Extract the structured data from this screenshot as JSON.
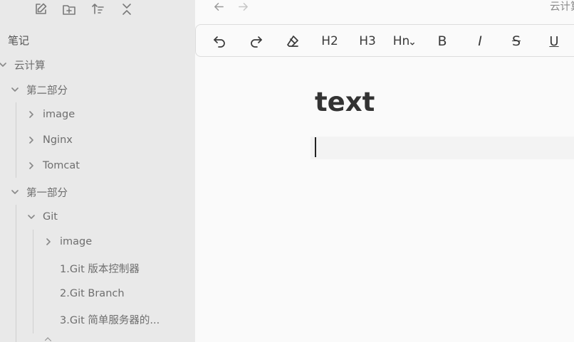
{
  "sidebar": {
    "toolbar": [
      {
        "name": "new-note-icon"
      },
      {
        "name": "new-folder-icon"
      },
      {
        "name": "sort-icon"
      },
      {
        "name": "collapse-all-icon"
      }
    ],
    "section_title": "笔记",
    "tree": [
      {
        "label": "云计算",
        "expanded": true
      },
      {
        "label": "第二部分",
        "expanded": true
      },
      {
        "label": "image",
        "expanded": false
      },
      {
        "label": "Nginx",
        "expanded": false
      },
      {
        "label": "Tomcat",
        "expanded": false
      },
      {
        "label": "第一部分",
        "expanded": true
      },
      {
        "label": "Git",
        "expanded": true
      },
      {
        "label": "image",
        "expanded": false
      },
      {
        "label": "1.Git 版本控制器"
      },
      {
        "label": "2.Git Branch"
      },
      {
        "label": "3.Git 简单服务器的..."
      }
    ]
  },
  "main": {
    "nav": {
      "back_icon": "arrow-left-icon",
      "forward_icon": "arrow-right-icon"
    },
    "doc_path": "云计算",
    "toolbar": {
      "undo": "undo-icon",
      "redo": "redo-icon",
      "clear_format": "eraser-icon",
      "h2": "H2",
      "h3": "H3",
      "hn": "Hn",
      "bold": "B",
      "italic": "I",
      "strike": "S",
      "underline": "U"
    },
    "heading": "text"
  },
  "colors": {
    "sidebar_bg": "#e9e9e9",
    "main_bg": "#fafafa",
    "text": "#333333"
  }
}
